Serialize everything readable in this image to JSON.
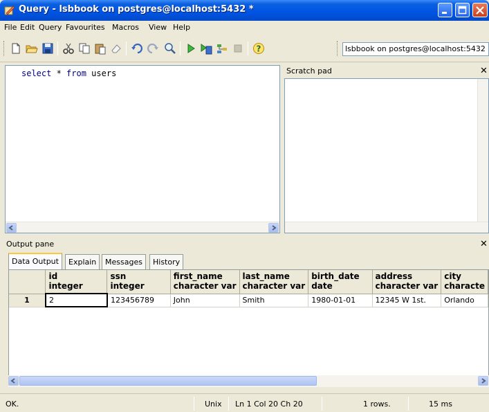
{
  "window": {
    "title": "Query - lsbbook on postgres@localhost:5432 *"
  },
  "menu": {
    "items": [
      "File",
      "Edit",
      "Query",
      "Favourites",
      "Macros",
      "View",
      "Help"
    ]
  },
  "toolbar": {
    "connection": "lsbbook on postgres@localhost:5432",
    "icons": [
      "new-file-icon",
      "open-folder-icon",
      "save-icon",
      "cut-icon",
      "copy-icon",
      "paste-icon",
      "clear-icon",
      "undo-icon",
      "redo-icon",
      "find-icon",
      "execute-icon",
      "execute-to-file-icon",
      "explain-icon",
      "cancel-icon",
      "help-icon"
    ]
  },
  "editor": {
    "sql_keyword1": "select",
    "sql_mid": " * ",
    "sql_keyword2": "from",
    "sql_tail": " users"
  },
  "scratch_pad": {
    "label": "Scratch pad"
  },
  "output": {
    "label": "Output pane",
    "tabs": [
      "Data Output",
      "Explain",
      "Messages",
      "History"
    ],
    "active_tab": "Data Output",
    "columns": [
      {
        "name": "id",
        "type": "integer"
      },
      {
        "name": "ssn",
        "type": "integer"
      },
      {
        "name": "first_name",
        "type": "character var"
      },
      {
        "name": "last_name",
        "type": "character var"
      },
      {
        "name": "birth_date",
        "type": "date"
      },
      {
        "name": "address",
        "type": "character var"
      },
      {
        "name": "city",
        "type": "characte"
      }
    ],
    "rows": [
      {
        "num": "1",
        "cells": [
          "2",
          "123456789",
          "John",
          "Smith",
          "1980-01-01",
          "12345 W 1st.",
          "Orlando"
        ]
      }
    ]
  },
  "status": {
    "state": "OK.",
    "line_endings": "Unix",
    "position": "Ln 1 Col 20 Ch 20",
    "rows": "1 rows.",
    "time": "15 ms"
  },
  "colors": {
    "title_bar": "#0054e3",
    "sql_keyword": "#00008b",
    "active_tab_accent": "#ffc83c"
  }
}
